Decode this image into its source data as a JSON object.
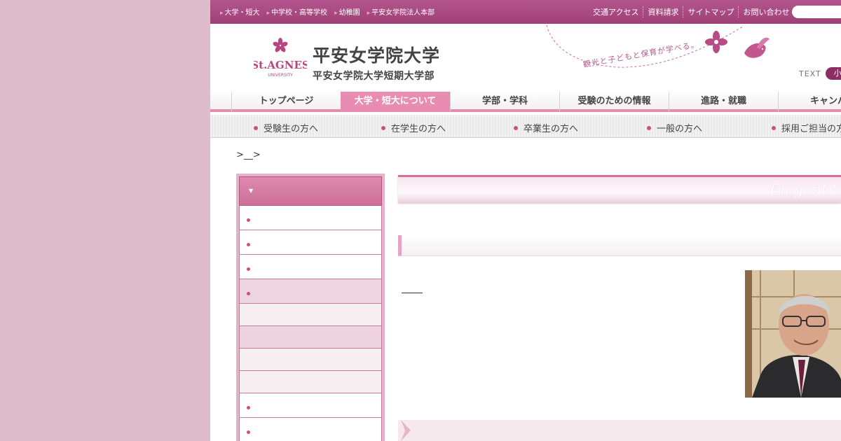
{
  "topbar": {
    "sites": [
      "大学・短大",
      "中学校・高等学校",
      "幼稚園",
      "平安女学院法人本部"
    ],
    "utils": [
      "交通アクセス",
      "資料請求",
      "サイトマップ",
      "お問い合わせ"
    ],
    "search_placeholder": ""
  },
  "header": {
    "crest_text": "St.AGNES",
    "crest_sub": "UNIVERSITY",
    "logo_main": "平安女学院大学",
    "logo_sub": "平安女学院大学短期大学部",
    "slogan": "観光と子どもと保育が学べる。",
    "text_size_label": "TEXT",
    "text_size_button": "小"
  },
  "gnav": [
    "トップページ",
    "大学・短大について",
    "学部・学科",
    "受験のための情報",
    "進路・就職",
    "キャンパス"
  ],
  "gnav_active_index": 1,
  "snav": [
    "受験生の方へ",
    "在学生の方へ",
    "卒業生の方へ",
    "一般の方へ",
    "採用ご担当の方へ"
  ],
  "breadcrumb": ">__>",
  "main": {
    "title_en": "Elegant lady"
  },
  "colors": {
    "topbar": "#a7467e",
    "accent": "#e88cb1",
    "background": "#dfbccb"
  }
}
